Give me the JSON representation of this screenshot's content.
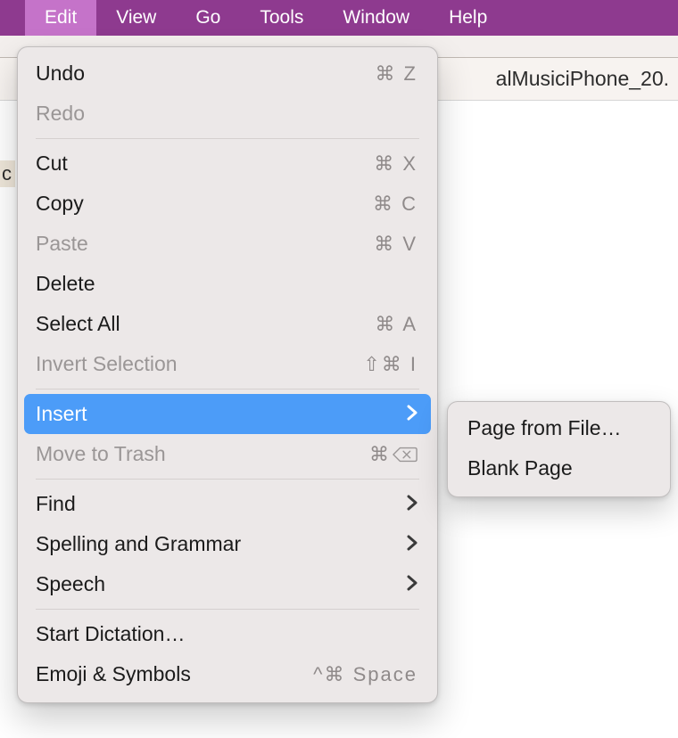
{
  "menubar": {
    "items": [
      "Edit",
      "View",
      "Go",
      "Tools",
      "Window",
      "Help"
    ],
    "open_index": 0
  },
  "document": {
    "visible_title_fragment": "alMusiciPhone_20."
  },
  "side_fragment": "c",
  "edit_menu": {
    "undo": {
      "label": "Undo",
      "shortcut": "⌘ Z",
      "enabled": true
    },
    "redo": {
      "label": "Redo",
      "shortcut": "",
      "enabled": false
    },
    "cut": {
      "label": "Cut",
      "shortcut": "⌘ X",
      "enabled": true
    },
    "copy": {
      "label": "Copy",
      "shortcut": "⌘ C",
      "enabled": true
    },
    "paste": {
      "label": "Paste",
      "shortcut": "⌘ V",
      "enabled": false
    },
    "delete": {
      "label": "Delete",
      "shortcut": "",
      "enabled": true
    },
    "select_all": {
      "label": "Select All",
      "shortcut": "⌘ A",
      "enabled": true
    },
    "invert_sel": {
      "label": "Invert Selection",
      "shortcut": "⇧⌘ I",
      "enabled": false
    },
    "insert": {
      "label": "Insert",
      "submenu": true,
      "highlighted": true
    },
    "move_trash": {
      "label": "Move to Trash",
      "shortcut": "⌘ ⌫",
      "enabled": false
    },
    "find": {
      "label": "Find",
      "submenu": true
    },
    "spelling": {
      "label": "Spelling and Grammar",
      "submenu": true
    },
    "speech": {
      "label": "Speech",
      "submenu": true
    },
    "dictation": {
      "label": "Start Dictation…",
      "shortcut": ""
    },
    "emoji": {
      "label": "Emoji & Symbols",
      "shortcut": "^⌘ Space"
    }
  },
  "insert_submenu": {
    "page_from_file": {
      "label": "Page from File…"
    },
    "blank_page": {
      "label": "Blank Page"
    }
  }
}
